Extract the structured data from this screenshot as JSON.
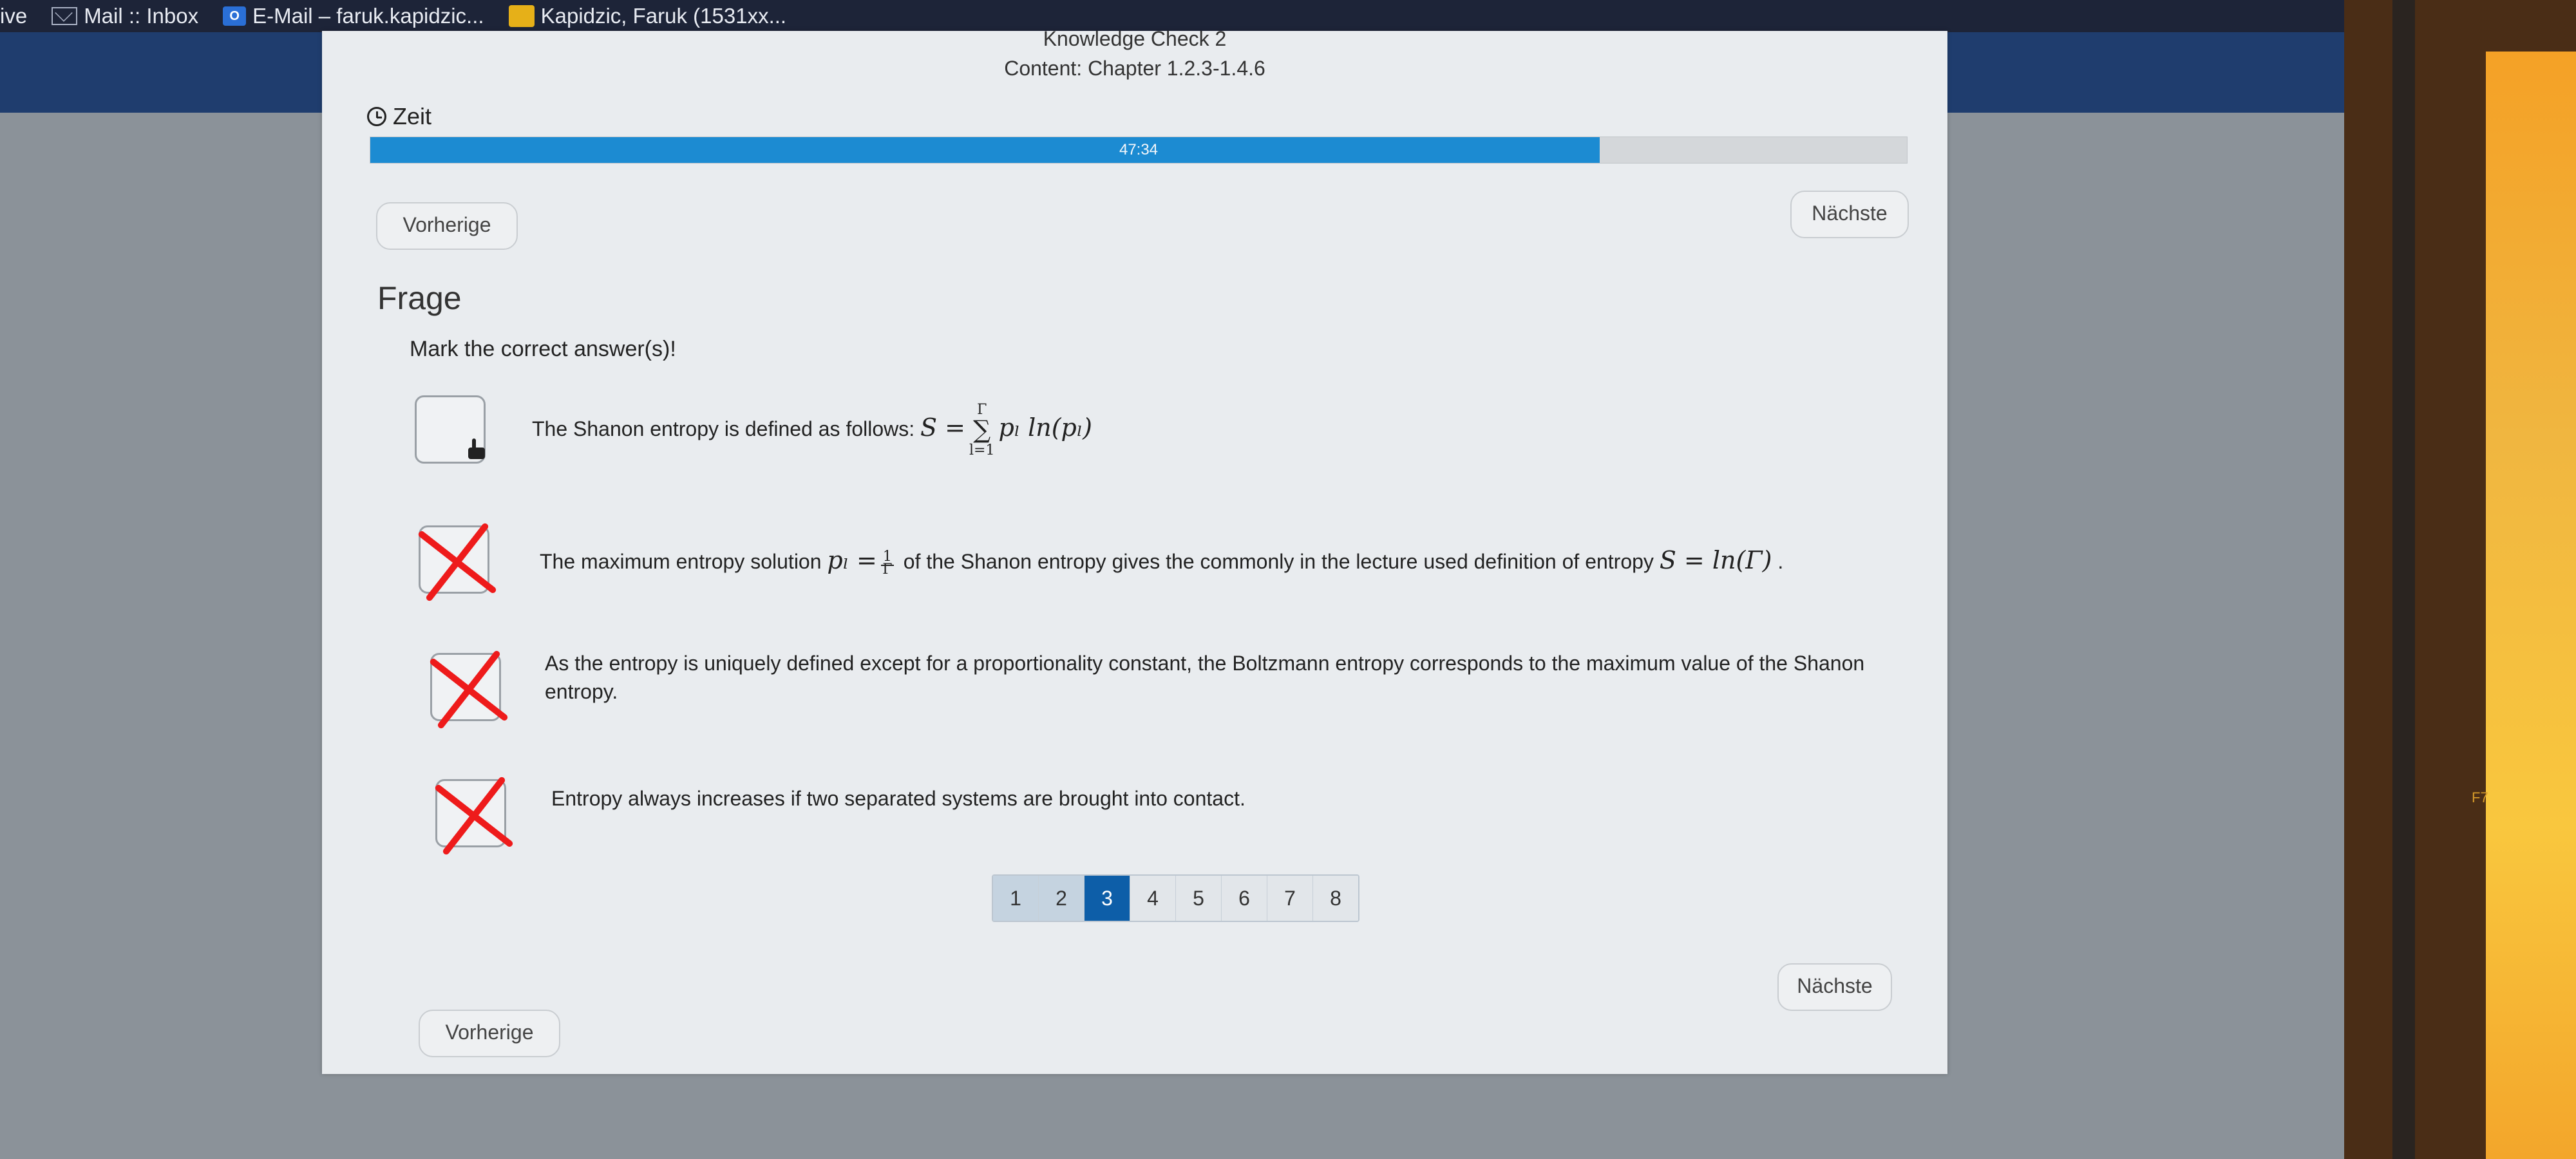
{
  "bookmarks": {
    "partial_left": "ive",
    "mail_inbox": "Mail :: Inbox",
    "email_outlook": "E-Mail – faruk.kapidzic...",
    "kapidzic": "Kapidzic, Faruk (1531xx..."
  },
  "quiz": {
    "title": "Knowledge Check 2",
    "subtitle": "Content: Chapter 1.2.3-1.4.6",
    "timer_label": "Zeit",
    "timer_value": "47:34",
    "progress_fraction": 0.8,
    "prev_label": "Vorherige",
    "next_label": "Nächste",
    "question_heading": "Frage",
    "instruction": "Mark the correct answer(s)!",
    "options": [
      {
        "text_before": "The Shanon entropy is defined as follows:",
        "math_lhs": "S =",
        "sum_upper": "Γ",
        "sum_lower": "l=1",
        "math_rhs": "pₗ ln(pₗ)",
        "crossed": false
      },
      {
        "text_before": "The maximum entropy solution",
        "math_var": "pₗ =",
        "frac_num": "1",
        "frac_den": "Γ",
        "text_after": "of the Shanon entropy gives the commonly in the lecture used definition of entropy",
        "math_end": "S = ln(Γ)",
        "trailing": ".",
        "crossed": true
      },
      {
        "text": "As the entropy is uniquely defined except for a proportionality constant, the Boltzmann entropy corresponds to the maximum value of the Shanon entropy.",
        "crossed": true
      },
      {
        "text": "Entropy always increases if two separated systems are brought into contact.",
        "crossed": true
      }
    ],
    "pages": [
      "1",
      "2",
      "3",
      "4",
      "5",
      "6",
      "7",
      "8"
    ],
    "current_page": "3"
  },
  "keyboard": {
    "key_label": "F7"
  },
  "colors": {
    "progress": "#1c8bd2",
    "current_page": "#0d5ea8",
    "cross_marks": "#ee1b1b",
    "header_strip": "#1f3d6e"
  }
}
